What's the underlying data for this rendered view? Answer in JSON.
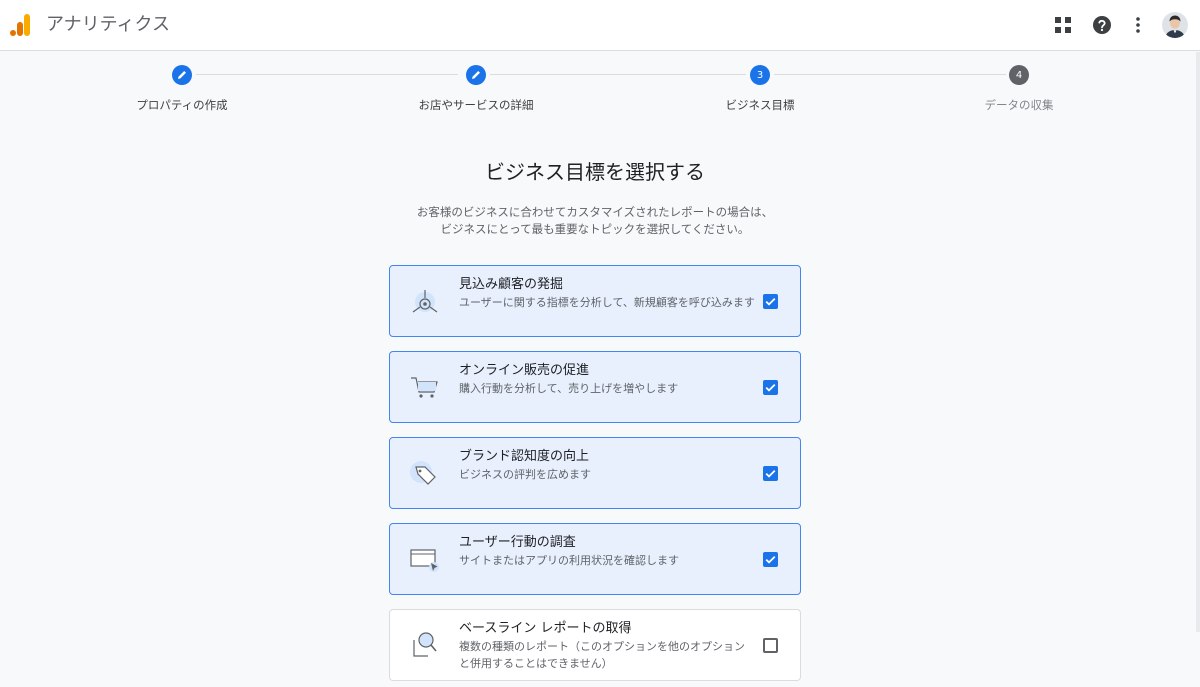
{
  "header": {
    "title": "アナリティクス",
    "icons": [
      "apps-grid-icon",
      "help-icon",
      "more-vert-icon"
    ]
  },
  "stepper": {
    "steps": [
      {
        "label": "プロパティの作成",
        "state": "done",
        "number": ""
      },
      {
        "label": "お店やサービスの詳細",
        "state": "done",
        "number": ""
      },
      {
        "label": "ビジネス目標",
        "state": "active",
        "number": "3"
      },
      {
        "label": "データの収集",
        "state": "pending",
        "number": "4"
      }
    ]
  },
  "main": {
    "title": "ビジネス目標を選択する",
    "description_line1": "お客様のビジネスに合わせてカスタマイズされたレポートの場合は、",
    "description_line2": "ビジネスにとって最も重要なトピックを選択してください。"
  },
  "goals": [
    {
      "title": "見込み顧客の発掘",
      "subtitle": "ユーザーに関する指標を分析して、新規顧客を呼び込みます",
      "checked": true,
      "icon": "lead-target-icon"
    },
    {
      "title": "オンライン販売の促進",
      "subtitle": "購入行動を分析して、売り上げを増やします",
      "checked": true,
      "icon": "cart-icon"
    },
    {
      "title": "ブランド認知度の向上",
      "subtitle": "ビジネスの評判を広めます",
      "checked": true,
      "icon": "tag-icon"
    },
    {
      "title": "ユーザー行動の調査",
      "subtitle": "サイトまたはアプリの利用状況を確認します",
      "checked": true,
      "icon": "browser-cursor-icon"
    },
    {
      "title": "ベースライン レポートの取得",
      "subtitle": "複数の種類のレポート（このオプションを他のオプションと併用することはできません）",
      "checked": false,
      "icon": "magnifier-doc-icon"
    }
  ],
  "colors": {
    "accent": "#1a73e8",
    "selected_bg": "#e8f0fe",
    "logo_orange": "#f9ab00",
    "logo_dark_orange": "#e37400"
  }
}
